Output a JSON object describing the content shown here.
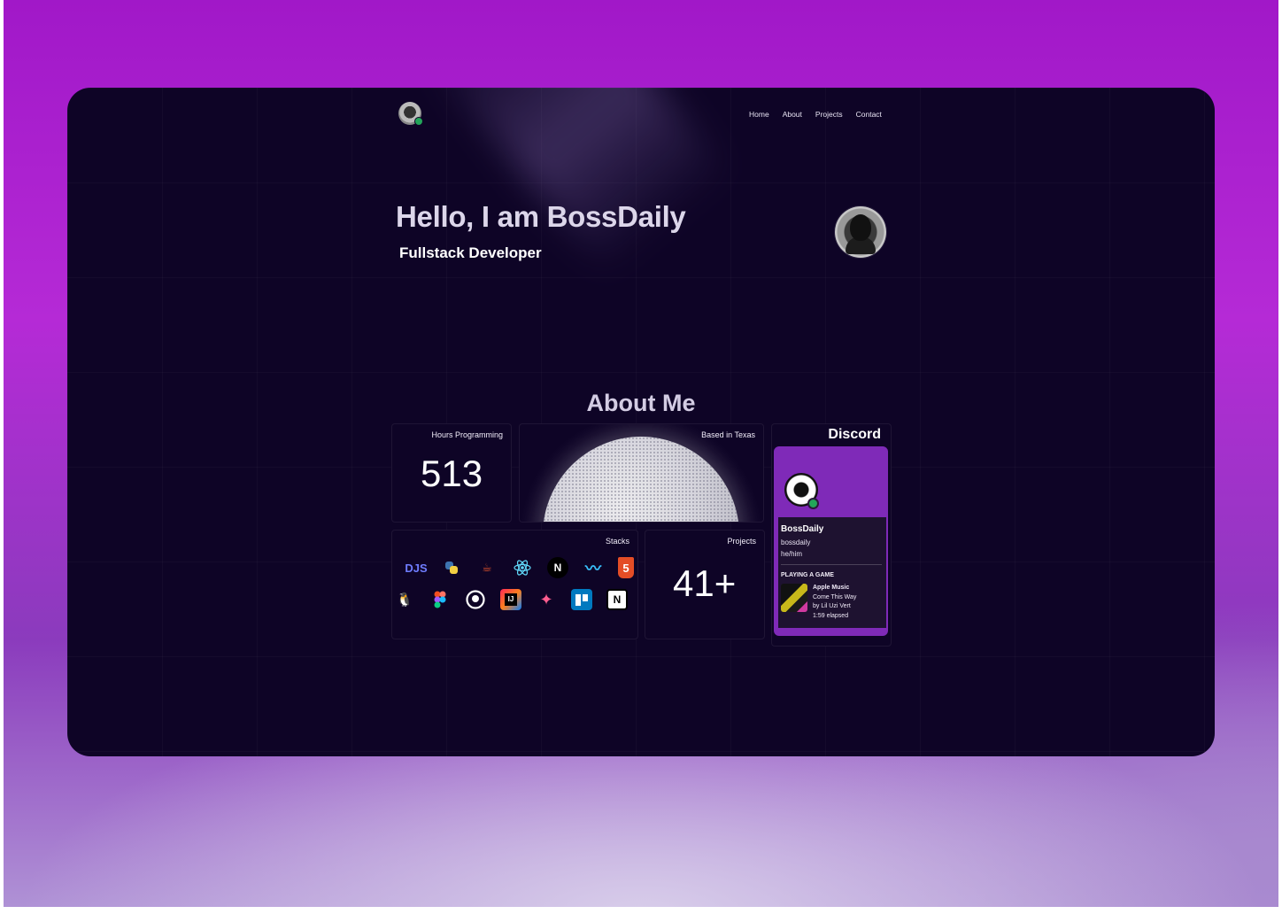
{
  "nav": {
    "links": [
      "Home",
      "About",
      "Projects",
      "Contact"
    ]
  },
  "hero": {
    "title": "Hello, I am BossDaily",
    "subtitle": "Fullstack Developer"
  },
  "about": {
    "title": "About Me",
    "hours": {
      "label": "Hours Programming",
      "value": "513"
    },
    "location": {
      "label": "Based in Texas"
    },
    "stacks": {
      "label": "Stacks",
      "row1": [
        "discordjs-icon",
        "python-icon",
        "java-icon",
        "react-icon",
        "nextjs-icon",
        "tailwind-icon",
        "html5-icon"
      ],
      "row2": [
        "linux-icon",
        "figma-icon",
        "github-icon",
        "intellij-icon",
        "astro-icon",
        "trello-icon",
        "notion-icon"
      ]
    },
    "projects": {
      "label": "Projects",
      "value": "41+"
    }
  },
  "discord": {
    "title": "Discord",
    "display_name": "BossDaily",
    "username": "bossdaily",
    "pronouns": "he/him",
    "activity_header": "PLAYING A GAME",
    "activity_app": "Apple Music",
    "activity_song": "Come This Way",
    "activity_artist": "by Lil Uzi Vert",
    "activity_elapsed": "1:59 elapsed",
    "status_color": "#23a55a"
  }
}
